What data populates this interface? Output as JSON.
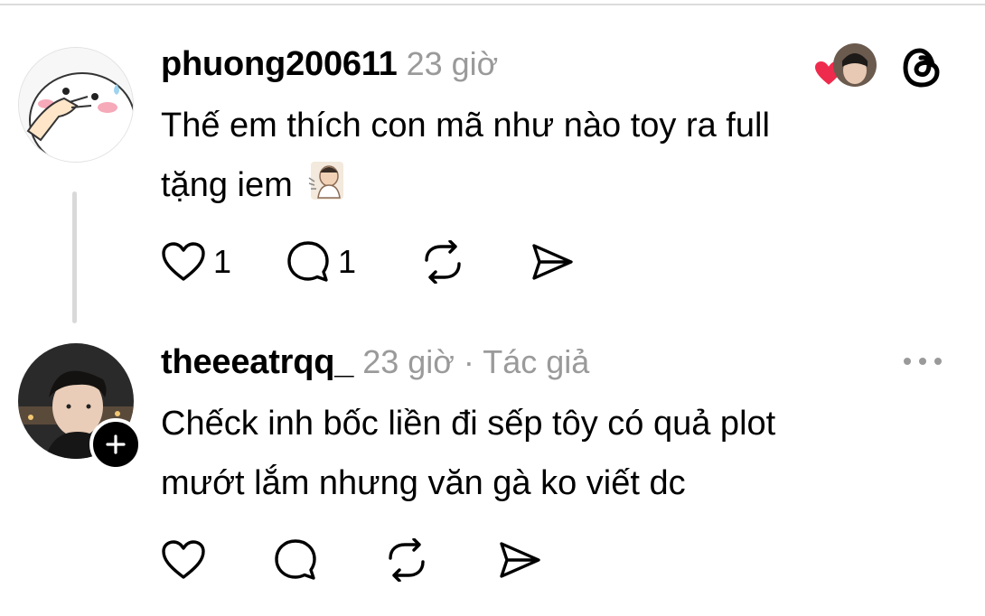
{
  "posts": [
    {
      "username": "phuong200611",
      "time": "23 giờ",
      "text_line1": "Thế em thích con mã như nào toy  ra full",
      "text_line2": "tặng iem",
      "like_count": "1",
      "comment_count": "1",
      "sticker_icon": "person-thinking-emoji"
    },
    {
      "username": "theeeatrqq_",
      "time": "23 giờ",
      "author_tag": "· Tác giả",
      "text_line1": "Chếck inh bốc liền đi sếp tôy có quả plot",
      "text_line2": "mướt lắm nhưng văn gà ko viết dc"
    }
  ],
  "colors": {
    "like_heart": "#ef2b4d",
    "meta_gray": "#9a9a9a",
    "thread_line": "#d9d9d9"
  },
  "icons": [
    "heart-icon",
    "comment-icon",
    "repost-icon",
    "share-icon",
    "threads-logo-icon",
    "more-icon",
    "follow-plus-icon"
  ]
}
